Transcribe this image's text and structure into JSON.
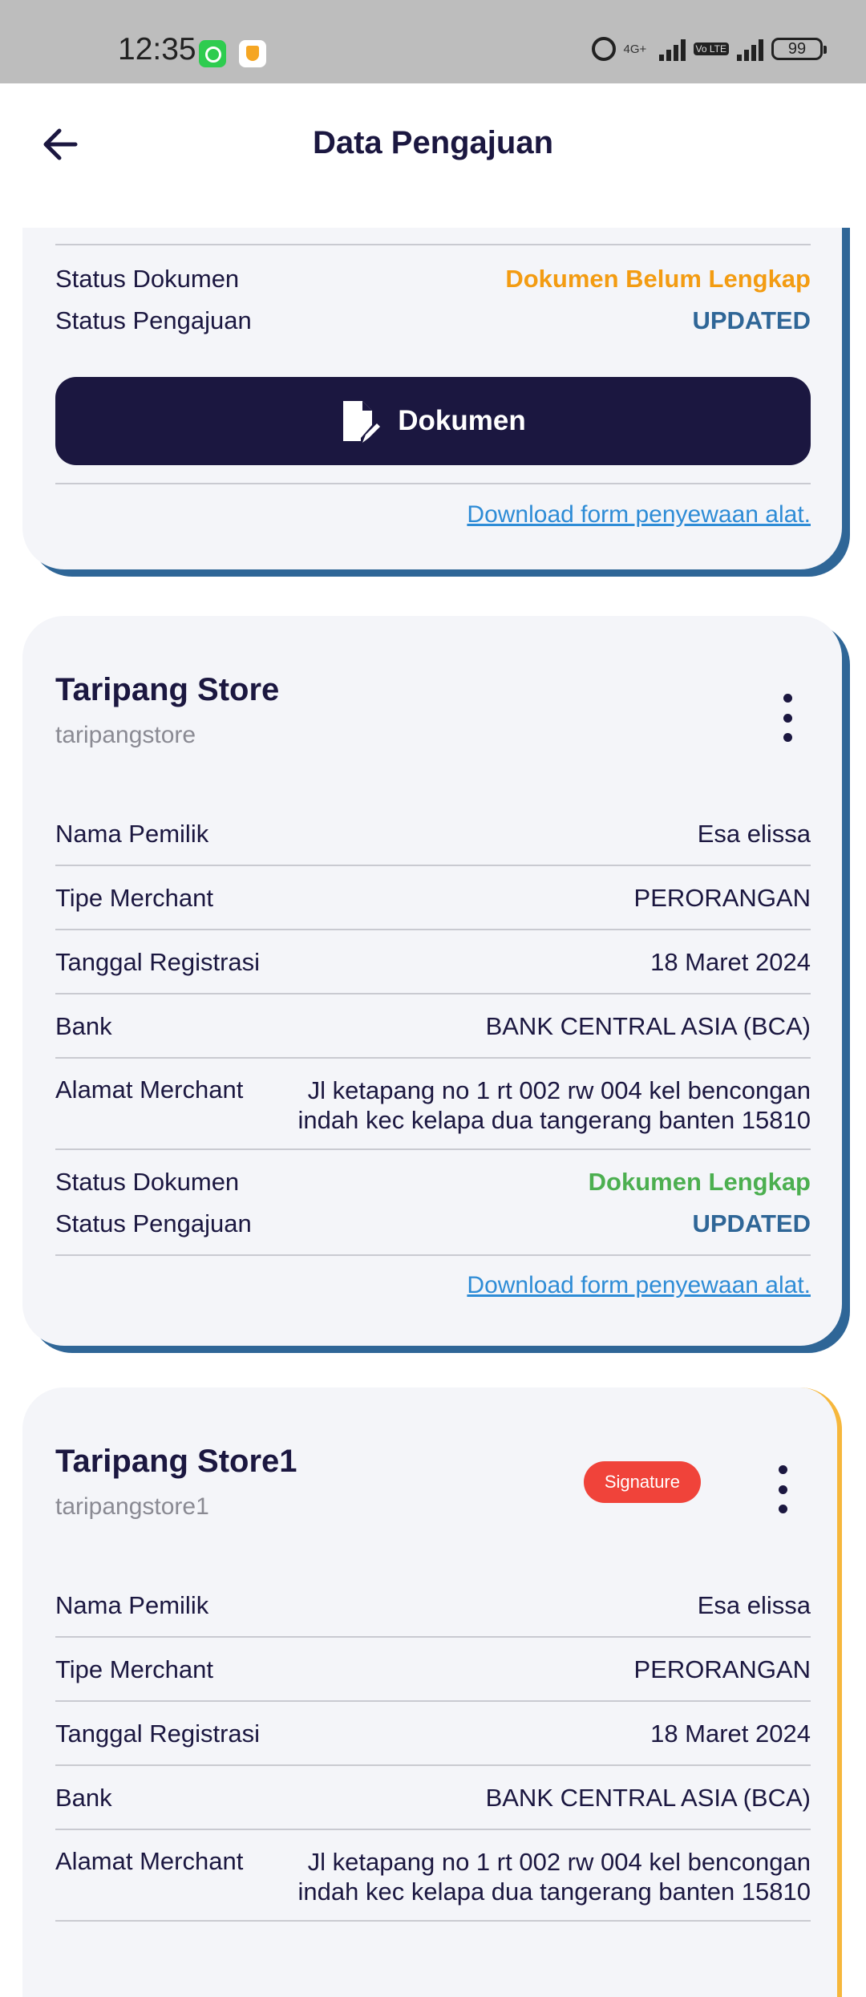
{
  "status_bar": {
    "time": "12:35",
    "network": "4G+",
    "volte": "Vo LTE",
    "battery": "99"
  },
  "app_bar": {
    "title": "Data Pengajuan"
  },
  "cards": [
    {
      "status_dokumen_label": "Status Dokumen",
      "status_dokumen_value": "Dokumen Belum Lengkap",
      "status_pengajuan_label": "Status Pengajuan",
      "status_pengajuan_value": "UPDATED",
      "button_label": "Dokumen",
      "download_link": "Download form penyewaan alat."
    },
    {
      "store_name": "Taripang Store",
      "username": "taripangstore",
      "fields": [
        {
          "label": "Nama Pemilik",
          "value": "Esa elissa"
        },
        {
          "label": "Tipe Merchant",
          "value": "PERORANGAN"
        },
        {
          "label": "Tanggal Registrasi",
          "value": "18 Maret 2024"
        },
        {
          "label": "Bank",
          "value": "BANK CENTRAL ASIA (BCA)"
        },
        {
          "label": "Alamat Merchant",
          "value": "Jl ketapang no 1 rt 002 rw 004 kel bencongan indah kec kelapa dua tangerang banten 15810"
        }
      ],
      "status_dokumen_label": "Status Dokumen",
      "status_dokumen_value": "Dokumen Lengkap",
      "status_pengajuan_label": "Status Pengajuan",
      "status_pengajuan_value": "UPDATED",
      "download_link": "Download form penyewaan alat."
    },
    {
      "store_name": "Taripang Store1",
      "username": "taripangstore1",
      "badge": "Signature",
      "fields": [
        {
          "label": "Nama Pemilik",
          "value": "Esa elissa"
        },
        {
          "label": "Tipe Merchant",
          "value": "PERORANGAN"
        },
        {
          "label": "Tanggal Registrasi",
          "value": "18 Maret 2024"
        },
        {
          "label": "Bank",
          "value": "BANK CENTRAL ASIA (BCA)"
        },
        {
          "label": "Alamat Merchant",
          "value": "Jl ketapang no 1 rt 002 rw 004 kel bencongan indah kec kelapa dua tangerang banten 15810"
        }
      ]
    }
  ],
  "colors": {
    "primary": "#1b1740",
    "accent_blue": "#2f6697",
    "status_orange": "#f39c12",
    "status_green": "#4caf50",
    "badge_red": "#f0433a",
    "card_bg": "#f4f5f9",
    "link": "#2e8cd6"
  }
}
